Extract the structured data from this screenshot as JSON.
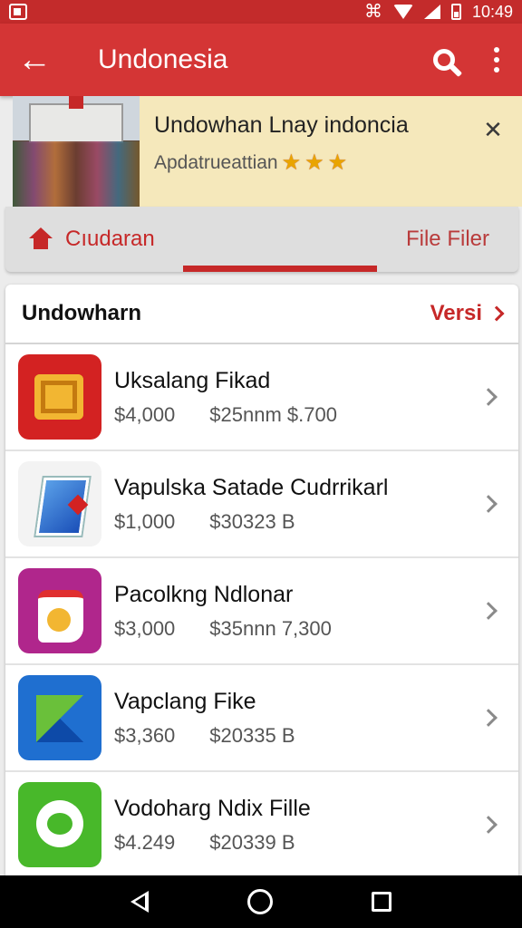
{
  "status_bar": {
    "time": "10:49",
    "icons": [
      "app-icon",
      "nfc-icon",
      "wifi-icon",
      "signal-icon",
      "battery-icon"
    ]
  },
  "app_bar": {
    "title": "Undonesia",
    "icons": [
      "back-arrow-icon",
      "search-icon",
      "more-vert-icon"
    ],
    "color": "#d43535"
  },
  "banner": {
    "title": "Undowhan Lnay indoncia",
    "subtitle": "Apdatrueattian",
    "rating_stars": 3,
    "close_icon": "close-icon"
  },
  "tabs": {
    "left_label": "Cıudaran",
    "right_label": "File Filer",
    "active_color": "#c62828"
  },
  "list": {
    "header_title": "Undowharn",
    "header_link": "Versi",
    "items": [
      {
        "name": "Uksalang Fikad",
        "price": "$4,000",
        "detail": "$25nnm $.700",
        "icon": "calculator-app-icon"
      },
      {
        "name": "Vapulska Satade Cudrrikarl",
        "price": "$1,000",
        "detail": "$30323 B",
        "icon": "pen-app-icon"
      },
      {
        "name": "Pacolkng Ndlonar",
        "price": "$3,000",
        "detail": "$35nnn 7,300",
        "icon": "gallery-app-icon"
      },
      {
        "name": "Vapclang Fike",
        "price": "$3,360",
        "detail": "$20335 B",
        "icon": "map-app-icon"
      },
      {
        "name": "Vodoharg Ndix Fille",
        "price": "$4.249",
        "detail": "$20339 B",
        "icon": "chat-app-icon"
      }
    ]
  },
  "nav_bar": {
    "icons": [
      "nav-back-icon",
      "nav-home-icon",
      "nav-recents-icon"
    ]
  }
}
